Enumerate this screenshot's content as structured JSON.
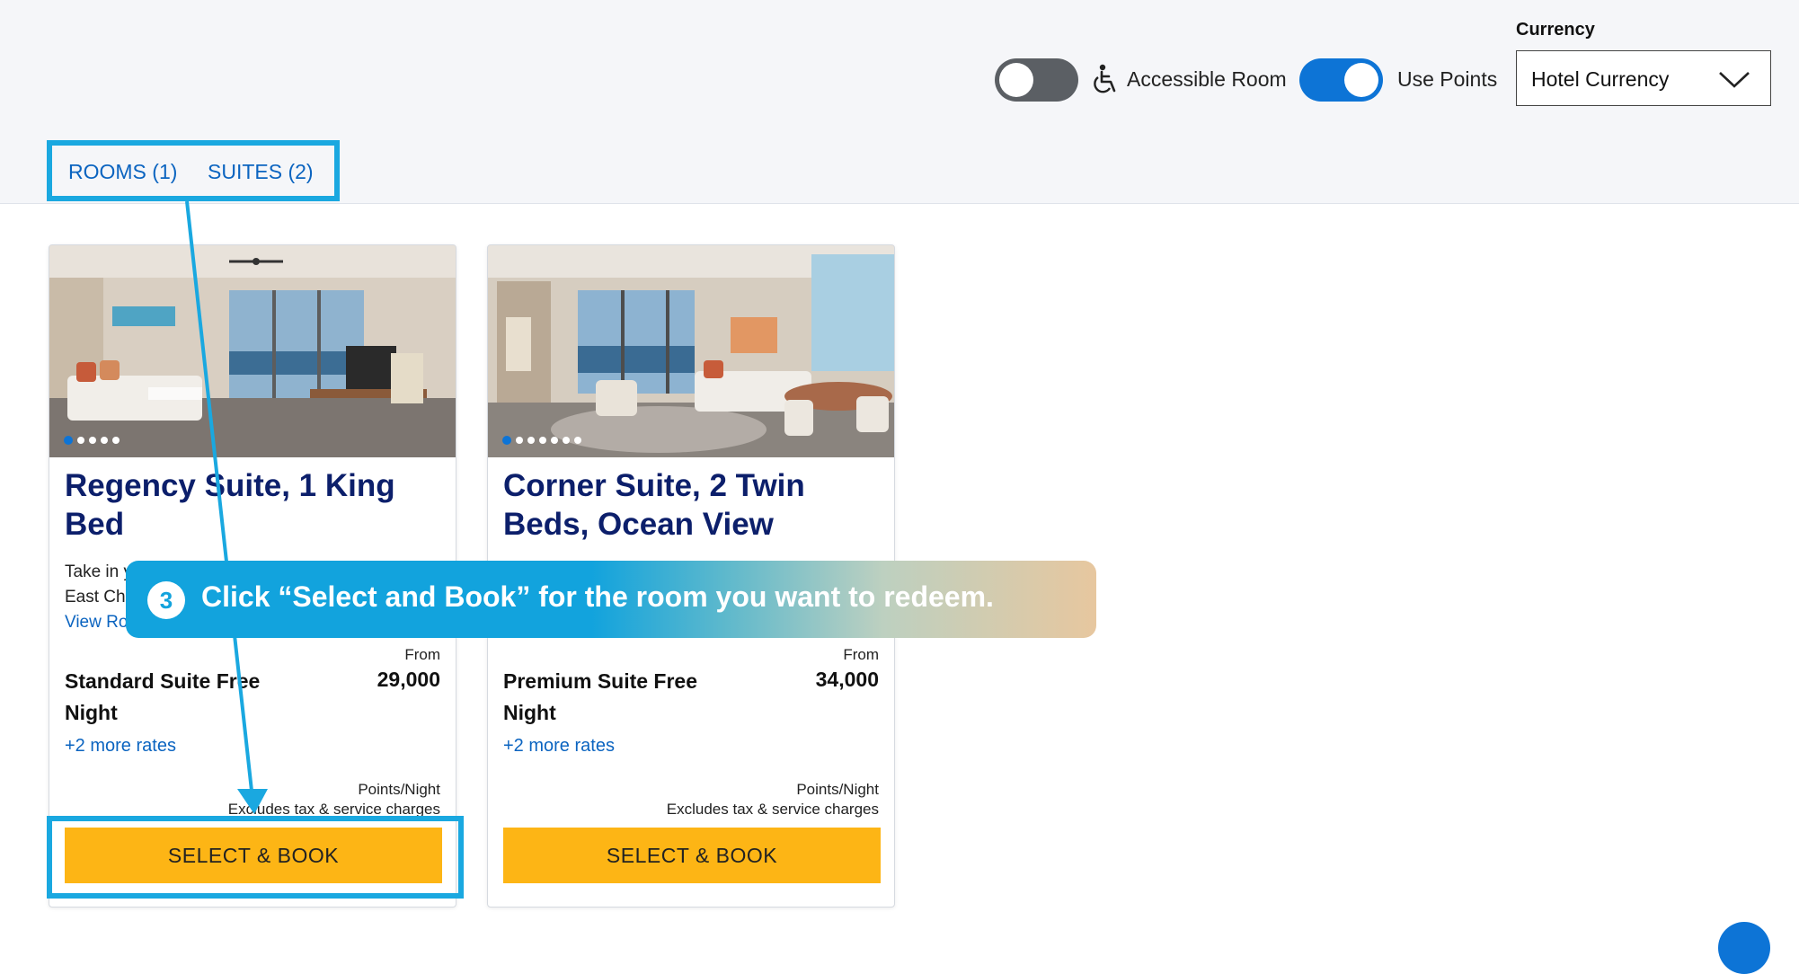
{
  "filters": {
    "accessible_room_label": "Accessible Room",
    "accessible_room_on": false,
    "use_points_label": "Use Points",
    "use_points_on": true,
    "currency_title": "Currency",
    "currency_value": "Hotel Currency"
  },
  "tabs": [
    {
      "label": "ROOMS (1)"
    },
    {
      "label": "SUITES (2)"
    }
  ],
  "rooms": [
    {
      "title": "Regency Suite, 1 King Bed",
      "description_start": "Take in y",
      "description_line2": "East Chi",
      "view_link": "View Ro",
      "slides": 5,
      "active_slide": 1,
      "rate_name": "Standard Suite Free Night",
      "from_label": "From",
      "points": "29,000",
      "more_rates": "+2 more rates",
      "per_night": "Points/Night",
      "excludes": "Excludes tax & service charges",
      "button": "SELECT & BOOK"
    },
    {
      "title": "Corner Suite, 2 Twin Beds, Ocean View",
      "slides": 7,
      "active_slide": 1,
      "rate_name": "Premium Suite Free Night",
      "from_label": "From",
      "points": "34,000",
      "more_rates": "+2 more rates",
      "per_night": "Points/Night",
      "excludes": "Excludes tax & service charges",
      "button": "SELECT & BOOK"
    }
  ],
  "annotation": {
    "step": "3",
    "text": "Click “Select and Book” for the room you want to redeem.",
    "color": "#12a3dd"
  },
  "colors": {
    "accent": "#0d74d6",
    "title": "#0c1f6b",
    "button": "#fdb515",
    "highlight": "#1aa8e0"
  }
}
